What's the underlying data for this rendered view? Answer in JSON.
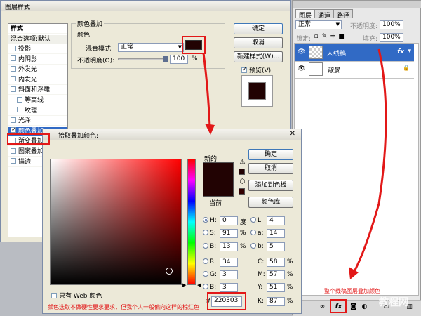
{
  "layer_style_dialog": {
    "title": "图层样式",
    "styles_header": "样式",
    "blend_default": "混合选项:默认",
    "styles": [
      {
        "label": "投影",
        "checked": false
      },
      {
        "label": "内阴影",
        "checked": false
      },
      {
        "label": "外发光",
        "checked": false
      },
      {
        "label": "内发光",
        "checked": false
      },
      {
        "label": "斜面和浮雕",
        "checked": false
      },
      {
        "label": "等高线",
        "checked": false,
        "sub": true
      },
      {
        "label": "纹理",
        "checked": false,
        "sub": true
      },
      {
        "label": "光泽",
        "checked": false
      },
      {
        "label": "颜色叠加",
        "checked": true,
        "selected": true
      },
      {
        "label": "渐变叠加",
        "checked": false
      },
      {
        "label": "图案叠加",
        "checked": false
      },
      {
        "label": "描边",
        "checked": false
      }
    ],
    "group_title": "颜色叠加",
    "subgroup_title": "颜色",
    "blend_mode_label": "混合模式:",
    "blend_mode_value": "正常",
    "opacity_label": "不透明度(O):",
    "opacity_value": "100",
    "opacity_unit": "%",
    "overlay_color": "#220303",
    "ok_label": "确定",
    "cancel_label": "取消",
    "new_style_label": "新建样式(W)...",
    "preview_label": "预览(V)",
    "preview_checked": true
  },
  "color_picker": {
    "title": "拾取叠加颜色:",
    "new_label": "新的",
    "current_label": "当前",
    "new_color": "#220303",
    "current_color": "#220303",
    "ok_label": "确定",
    "cancel_label": "取消",
    "add_swatch_label": "添加到色板",
    "libraries_label": "颜色库",
    "web_only_label": "只有 Web 颜色",
    "hsb": {
      "h": {
        "label": "H:",
        "value": "0",
        "unit": "度",
        "selected": true
      },
      "s": {
        "label": "S:",
        "value": "91",
        "unit": "%"
      },
      "b": {
        "label": "B:",
        "value": "13",
        "unit": "%"
      }
    },
    "lab": {
      "l": {
        "label": "L:",
        "value": "4"
      },
      "a": {
        "label": "a:",
        "value": "14"
      },
      "b": {
        "label": "b:",
        "value": "5"
      }
    },
    "rgb": {
      "r": {
        "label": "R:",
        "value": "34"
      },
      "g": {
        "label": "G:",
        "value": "3"
      },
      "b": {
        "label": "B:",
        "value": "3"
      }
    },
    "cmyk": {
      "c": {
        "label": "C:",
        "value": "58",
        "unit": "%"
      },
      "m": {
        "label": "M:",
        "value": "57",
        "unit": "%"
      },
      "y": {
        "label": "Y:",
        "value": "51",
        "unit": "%"
      },
      "k": {
        "label": "K:",
        "value": "87",
        "unit": "%"
      }
    },
    "hex_label": "#",
    "hex_value": "220303"
  },
  "layers_panel": {
    "tabs": [
      {
        "label": "图层",
        "active": true
      },
      {
        "label": "通道",
        "active": false
      },
      {
        "label": "路径",
        "active": false
      }
    ],
    "blend_mode": "正常",
    "opacity_label": "不透明度:",
    "opacity_value": "100%",
    "lock_label": "锁定:",
    "fill_label": "填充:",
    "fill_value": "100%",
    "layers": [
      {
        "name": "人线稿",
        "selected": true,
        "fx": "fx"
      },
      {
        "name": "背景",
        "selected": false,
        "locked": true
      }
    ]
  },
  "annotations": {
    "color_note": "颜色选取不做硬性要求要求，但我个人一般偏向这样的棕红色",
    "layer_note": "整个线稿图层叠加颜色",
    "watermark": "教程网"
  },
  "colors": {
    "accent_red": "#e21818",
    "selection_blue": "#316ac5"
  }
}
